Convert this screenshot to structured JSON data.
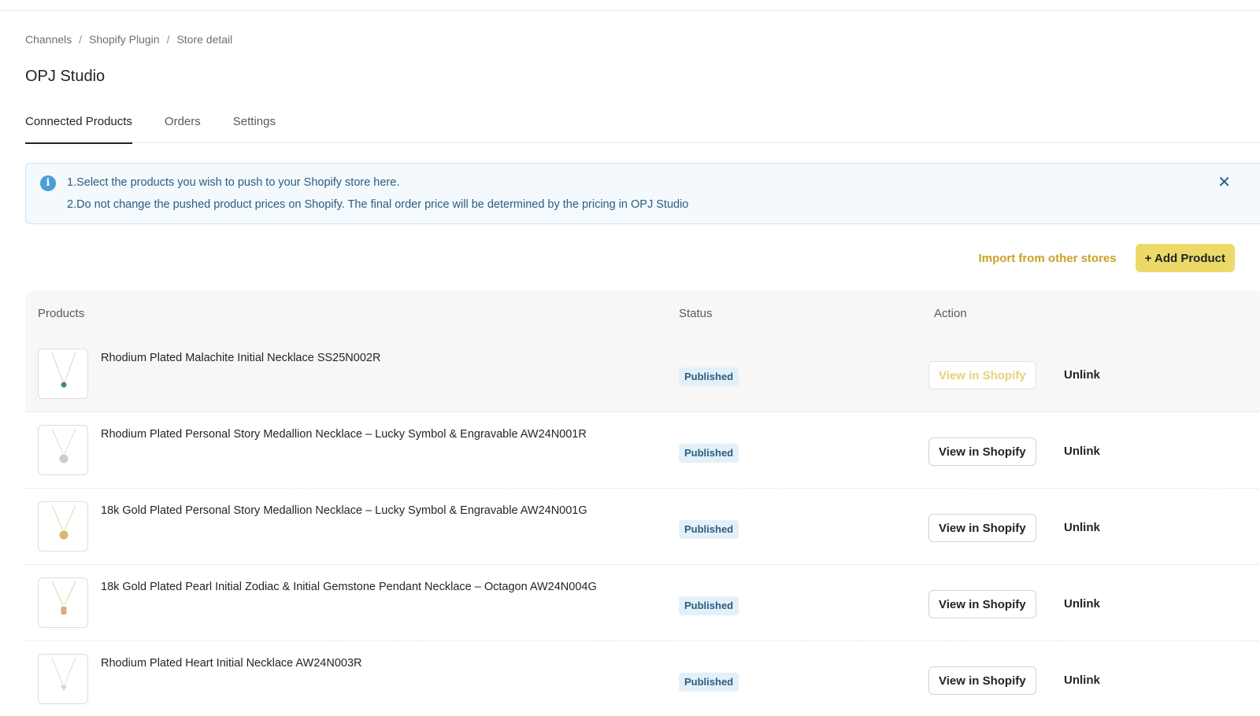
{
  "breadcrumb": {
    "items": [
      "Channels",
      "Shopify Plugin",
      "Store detail"
    ],
    "separator": "/"
  },
  "page": {
    "title": "OPJ Studio"
  },
  "tabs": [
    {
      "label": "Connected Products",
      "active": true
    },
    {
      "label": "Orders",
      "active": false
    },
    {
      "label": "Settings",
      "active": false
    }
  ],
  "notice": {
    "icon": "info-icon",
    "line1": "1.Select the products you wish to push to your Shopify store here.",
    "line2": "2.Do not change the pushed product prices on Shopify. The final order price will be determined by the pricing in OPJ Studio",
    "close_icon": "close-icon"
  },
  "toolbar": {
    "import_label": "Import from other stores",
    "add_label": "+ Add Product",
    "accent_color": "#ecd968"
  },
  "table": {
    "columns": [
      "Products",
      "Status",
      "Action"
    ],
    "rows": [
      {
        "name": "Rhodium Plated Malachite Initial Necklace SS25N002R",
        "status": "Published",
        "view_label": "View in Shopify",
        "unlink_label": "Unlink",
        "pendant": "#3f8f6a"
      },
      {
        "name": "Rhodium Plated Personal Story Medallion Necklace – Lucky Symbol & Engravable AW24N001R",
        "status": "Published",
        "view_label": "View in Shopify",
        "unlink_label": "Unlink",
        "pendant": "#c9ccd0"
      },
      {
        "name": "18k Gold Plated Personal Story Medallion Necklace – Lucky Symbol & Engravable AW24N001G",
        "status": "Published",
        "view_label": "View in Shopify",
        "unlink_label": "Unlink",
        "pendant": "#d9b56a"
      },
      {
        "name": "18k Gold Plated Pearl Initial Zodiac & Initial Gemstone Pendant Necklace – Octagon AW24N004G",
        "status": "Published",
        "view_label": "View in Shopify",
        "unlink_label": "Unlink",
        "pendant": "#d8a98c"
      },
      {
        "name": "Rhodium Plated Heart Initial Necklace AW24N003R",
        "status": "Published",
        "view_label": "View in Shopify",
        "unlink_label": "Unlink",
        "pendant": "#d4d7db"
      }
    ]
  }
}
